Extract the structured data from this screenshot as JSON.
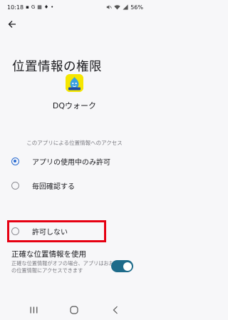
{
  "status_bar": {
    "time": "10:18",
    "battery": "56%",
    "left_icons": [
      "dq-icon",
      "g-icon",
      "grid-icon",
      "wallet-icon",
      "dot"
    ],
    "right_icons": [
      "mute-icon",
      "wifi-icon",
      "signal-icon"
    ]
  },
  "header": {
    "back_icon": "back-arrow-icon"
  },
  "page": {
    "title": "位置情報の権限"
  },
  "app": {
    "name": "DQウォーク",
    "icon": "dq-walk-app-icon",
    "icon_color": "#f5e600"
  },
  "permission": {
    "section_label": "このアプリによる位置情報へのアクセス",
    "options": [
      {
        "label": "アプリの使用中のみ許可",
        "selected": true
      },
      {
        "label": "毎回確認する",
        "selected": false
      },
      {
        "label": "許可しない",
        "selected": false
      }
    ]
  },
  "precise_location": {
    "title": "正確な位置情報を使用",
    "description": "正確な位置情報がオフの場合、アプリはおおよその位置情報にアクセスできます",
    "enabled": true
  },
  "colors": {
    "accent": "#2b6cd1",
    "toggle_on": "#1e6b8a",
    "highlight": "#e60012"
  },
  "nav_bar": {
    "icons": [
      "recents-icon",
      "home-icon",
      "back-icon"
    ]
  }
}
